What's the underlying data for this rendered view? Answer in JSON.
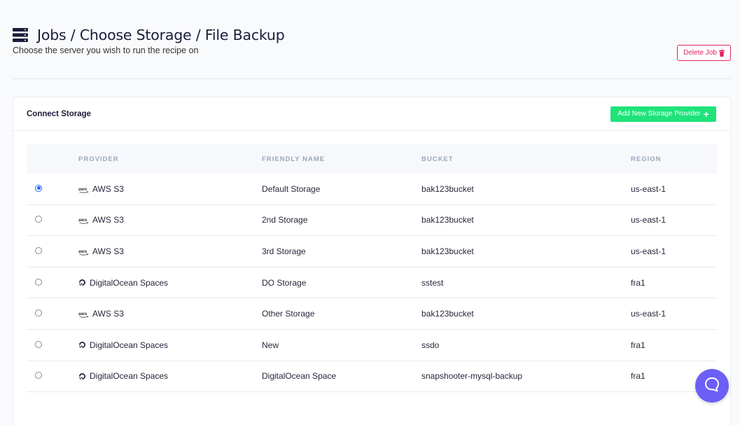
{
  "header": {
    "title": "Jobs / Choose Storage / File Backup",
    "subtitle": "Choose the server you wish to run the recipe on",
    "delete_label": "Delete Job"
  },
  "card": {
    "title": "Connect Storage",
    "add_label": "Add New Storage Provider"
  },
  "table": {
    "columns": [
      "PROVIDER",
      "FRIENDLY NAME",
      "BUCKET",
      "REGION"
    ],
    "rows": [
      {
        "selected": true,
        "provider_icon": "aws-icon",
        "provider": "AWS S3",
        "name": "Default Storage",
        "bucket": "bak123bucket",
        "region": "us-east-1"
      },
      {
        "selected": false,
        "provider_icon": "aws-icon",
        "provider": "AWS S3",
        "name": "2nd Storage",
        "bucket": "bak123bucket",
        "region": "us-east-1"
      },
      {
        "selected": false,
        "provider_icon": "aws-icon",
        "provider": "AWS S3",
        "name": "3rd Storage",
        "bucket": "bak123bucket",
        "region": "us-east-1"
      },
      {
        "selected": false,
        "provider_icon": "digitalocean-icon",
        "provider": "DigitalOcean Spaces",
        "name": "DO Storage",
        "bucket": "sstest",
        "region": "fra1"
      },
      {
        "selected": false,
        "provider_icon": "aws-icon",
        "provider": "AWS S3",
        "name": "Other Storage",
        "bucket": "bak123bucket",
        "region": "us-east-1"
      },
      {
        "selected": false,
        "provider_icon": "digitalocean-icon",
        "provider": "DigitalOcean Spaces",
        "name": "New",
        "bucket": "ssdo",
        "region": "fra1"
      },
      {
        "selected": false,
        "provider_icon": "digitalocean-icon",
        "provider": "DigitalOcean Spaces",
        "name": "DigitalOcean Space",
        "bucket": "snapshooter-mysql-backup",
        "region": "fra1"
      }
    ]
  },
  "colors": {
    "accent_green": "#1ee37a",
    "danger": "#e0245e",
    "selected_radio": "#2962ff",
    "chat_button": "#6c5ff5"
  }
}
